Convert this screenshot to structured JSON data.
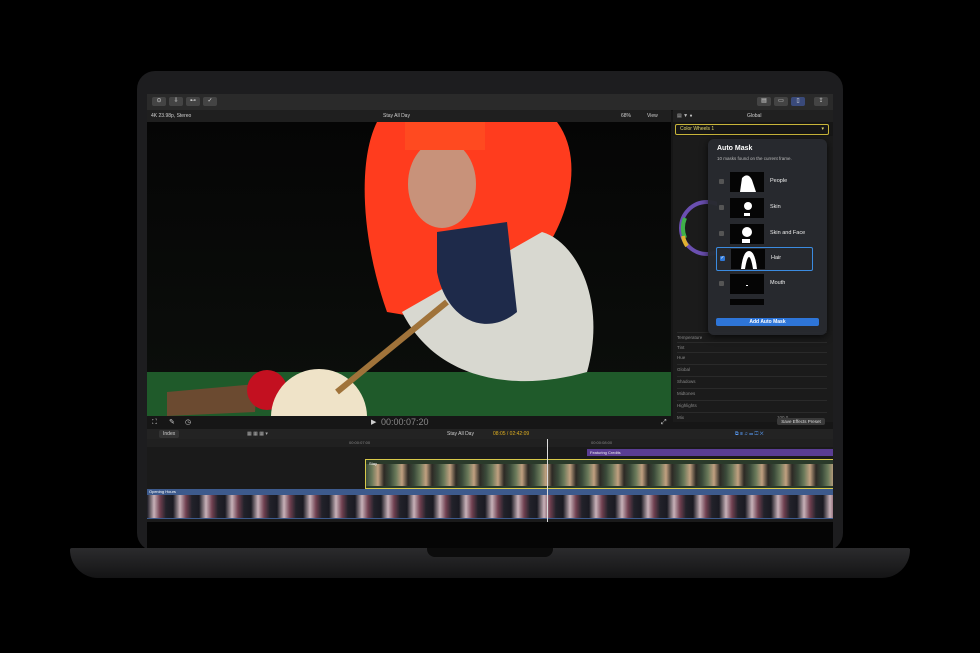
{
  "toolbar": {
    "save_icon": "⊙",
    "share_icon": "⇪"
  },
  "viewer": {
    "format_info": "4K 23.98p, Stereo",
    "project_name": "Stay All Day",
    "zoom": "68%",
    "view_label": "View",
    "timecode": "00:00:07:20"
  },
  "inspector": {
    "tab_label": "Global",
    "effect_selector": "Color Wheels 1",
    "rows": [
      "Temperature",
      "Tint",
      "Hue",
      "Global",
      "Shadows",
      "Midtones",
      "Highlights",
      "Mix"
    ],
    "mix_value": "100.0",
    "save_preset": "Save Effects Preset"
  },
  "auto_mask": {
    "title": "Auto Mask",
    "subtitle": "10 masks found on the current frame.",
    "masks": [
      {
        "label": "People",
        "checked": false
      },
      {
        "label": "Skin",
        "checked": false
      },
      {
        "label": "Skin and Face",
        "checked": false
      },
      {
        "label": "Hair",
        "checked": true
      },
      {
        "label": "Mouth",
        "checked": false
      }
    ],
    "add_button": "Add Auto Mask"
  },
  "timeline": {
    "index_label": "Index",
    "project_name": "Stay All Day",
    "duration": "08:05 / 02:42:09",
    "ruler_marks": [
      "00:00:07:00",
      "00:00:08:00"
    ],
    "clip_top_label": "Stay",
    "purple_clip": "Featuring Credits",
    "primary_clip": "Opening Hours"
  },
  "colors": {
    "accent": "#2f78d8",
    "selection_yellow": "#d8c94a",
    "primary_clip": "#3d5a8c",
    "purple_clip": "#5a3d93"
  }
}
